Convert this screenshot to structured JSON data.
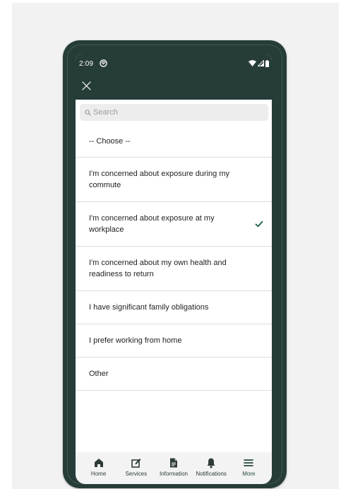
{
  "status_bar": {
    "time": "2:09"
  },
  "search": {
    "placeholder": "Search"
  },
  "options": [
    {
      "label": "-- Choose --",
      "selected": false
    },
    {
      "label": "I'm concerned about exposure during my commute",
      "selected": false
    },
    {
      "label": "I'm concerned about exposure at my workplace",
      "selected": true
    },
    {
      "label": "I'm concerned about my own health and readiness to return",
      "selected": false
    },
    {
      "label": "I have significant family obligations",
      "selected": false
    },
    {
      "label": "I prefer working from home",
      "selected": false
    },
    {
      "label": "Other",
      "selected": false
    }
  ],
  "bottom_nav": {
    "items": [
      {
        "label": "Home",
        "icon": "home-icon"
      },
      {
        "label": "Services",
        "icon": "edit-icon"
      },
      {
        "label": "Information",
        "icon": "document-icon"
      },
      {
        "label": "Notifications",
        "icon": "bell-icon"
      },
      {
        "label": "More",
        "icon": "menu-icon"
      }
    ]
  },
  "colors": {
    "frame": "#263c38",
    "accent": "#2b6b58",
    "divider": "#dcdcdc",
    "nav_background": "#f3f3f3"
  }
}
